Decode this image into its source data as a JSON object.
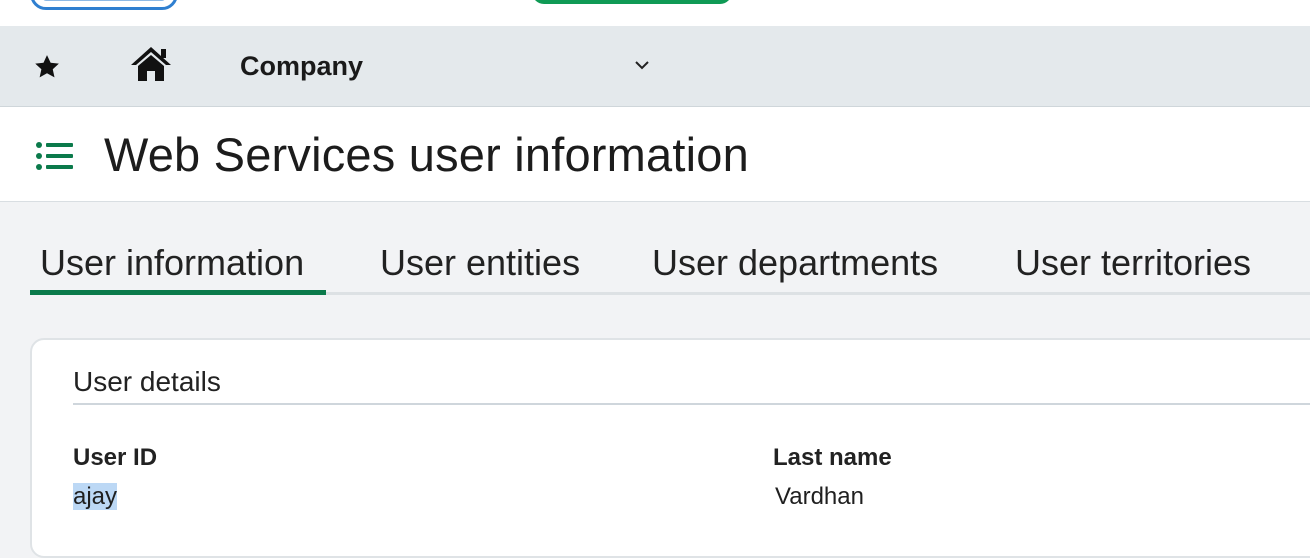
{
  "nav": {
    "company_label": "Company",
    "icons": [
      "star-icon",
      "home-icon",
      "chevron-down-icon"
    ]
  },
  "header": {
    "title": "Web Services user information",
    "icon": "list-icon",
    "accent_color": "#0b7a4b"
  },
  "tabs": [
    {
      "label": "User information",
      "active": true
    },
    {
      "label": "User entities",
      "active": false
    },
    {
      "label": "User departments",
      "active": false
    },
    {
      "label": "User territories",
      "active": false
    }
  ],
  "card": {
    "title": "User details",
    "fields": [
      {
        "label": "User ID",
        "value": "ajay",
        "selected": true
      },
      {
        "label": "Last name",
        "value": "Vardhan",
        "selected": false
      }
    ]
  }
}
